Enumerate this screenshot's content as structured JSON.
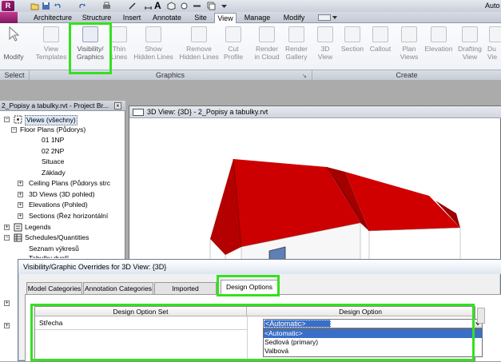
{
  "app": {
    "title_fragment": "Auto"
  },
  "ribbon_tabs": [
    "Architecture",
    "Structure",
    "Insert",
    "Annotate",
    "Site",
    "View",
    "Manage",
    "Modify"
  ],
  "active_tab": "View",
  "ribbon_buttons": {
    "modify": "Modify",
    "view_templates": [
      "View",
      "Templates"
    ],
    "visibility_graphics": [
      "Visibility/",
      "Graphics"
    ],
    "thin_lines": [
      "Thin",
      "Lines"
    ],
    "show_hidden_lines": [
      "Show",
      "Hidden Lines"
    ],
    "remove_hidden_lines": [
      "Remove",
      "Hidden Lines"
    ],
    "cut_profile": [
      "Cut",
      "Profile"
    ],
    "render_in_cloud": [
      "Render",
      "in Cloud"
    ],
    "render_gallery": [
      "Render",
      "Gallery"
    ],
    "view_3d": [
      "3D",
      "View"
    ],
    "section": "Section",
    "callout": "Callout",
    "plan_views": [
      "Plan",
      "Views"
    ],
    "elevation": "Elevation",
    "drafting_view": [
      "Drafting",
      "View"
    ],
    "duplicate_view": [
      "Du",
      "Vie"
    ]
  },
  "panels": {
    "select": "Select",
    "graphics": "Graphics",
    "create": "Create"
  },
  "browser": {
    "title": "2_Popisy a tabulky.rvt - Project Br...",
    "items": {
      "views": "Views (všechny)",
      "floor_plans": "Floor Plans (Půdorys)",
      "plan_1np": "01 1NP",
      "plan_2np": "02 2NP",
      "situace": "Situace",
      "zaklady": "Základy",
      "ceiling_plans": "Ceiling Plans (Půdorys strc",
      "views_3d": "3D Views (3D pohled)",
      "elevations": "Elevations (Pohled)",
      "sections": "Sections (Řez horizontální",
      "legends": "Legends",
      "schedules": "Schedules/Quantities",
      "seznam": "Seznam výkresů",
      "tabulky": "Tabulky dveří"
    }
  },
  "view_window": {
    "title": "3D View: {3D} - 2_Popisy a tabulky.rvt"
  },
  "dialog": {
    "title": "Visibility/Graphic Overrides for 3D View: {3D}",
    "tabs": [
      "Model Categories",
      "Annotation Categories",
      "Imported Categories",
      "Design Options"
    ],
    "active_tab": "Design Options",
    "columns": [
      "Design Option Set",
      "Design Option"
    ],
    "rows": [
      {
        "set": "Střecha",
        "option": "<Automatic>"
      }
    ],
    "dropdown_options": [
      "<Automatic>",
      "Sedlová (primary)",
      "Valbová"
    ],
    "dropdown_selected": "<Automatic>"
  },
  "colors": {
    "highlight": "#35e020",
    "roof": "#cc0000",
    "selection": "#3a6fc8"
  }
}
